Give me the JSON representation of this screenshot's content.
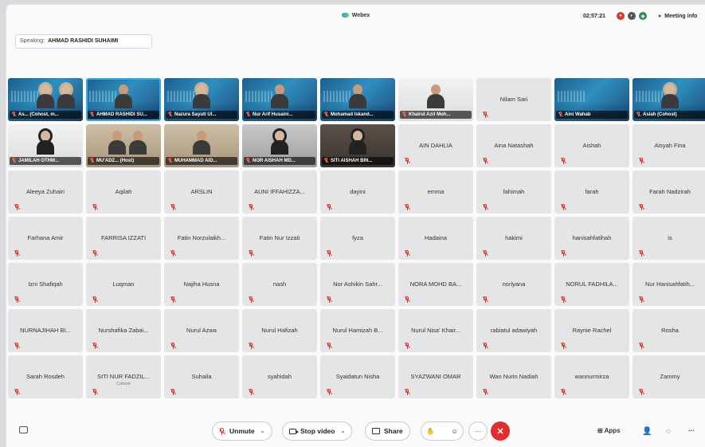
{
  "app": {
    "title": "Webex"
  },
  "topbar": {
    "clock": "02:57:21",
    "meeting_info": "Meeting info"
  },
  "speaking": {
    "label": "Speaking:",
    "name": "AHMAD RASHIDI SUHAIMI"
  },
  "participants": [
    {
      "name": "As... (Cohost, m...",
      "video": "blue",
      "person": "hijab2"
    },
    {
      "name": "AHMAD RASHIDI SU...",
      "video": "blue",
      "person": "man",
      "selected": true
    },
    {
      "name": "Nazura Sayuti Ul...",
      "video": "blue",
      "person": "hijab"
    },
    {
      "name": "Nur Arif Husaini...",
      "video": "blue",
      "person": "man"
    },
    {
      "name": "Mohamad Iskand...",
      "video": "blue",
      "person": "man"
    },
    {
      "name": "Khairul Azri Moh...",
      "video": "white",
      "person": "man"
    },
    {
      "name": "Nilam Sari"
    },
    {
      "name": "Aini Wahab",
      "video": "blue",
      "person": "none"
    },
    {
      "name": "Asiah (Cohost)",
      "video": "blue",
      "person": "hijab"
    },
    {
      "name": "JAMILAH OTHM...",
      "video": "white",
      "person": "hijabdk"
    },
    {
      "name": "MU'ADZ...        (Host)",
      "video": "room",
      "person": "man2"
    },
    {
      "name": "MUHAMMAD AID...",
      "video": "room",
      "person": "man"
    },
    {
      "name": "NOR AISHAH MD...",
      "video": "gray",
      "person": "hijabdk"
    },
    {
      "name": "SITI AISHAH BIN...",
      "video": "dark",
      "person": "hijabdk"
    },
    {
      "name": "AIN DAHLIA"
    },
    {
      "name": "Aina Natashah"
    },
    {
      "name": "Aishah"
    },
    {
      "name": "Aisyah Fina"
    },
    {
      "name": "Aleeya Zuhairi"
    },
    {
      "name": "Aqilah"
    },
    {
      "name": "ARSLIN"
    },
    {
      "name": "AUNI IFFAHIZZA..."
    },
    {
      "name": "dayini"
    },
    {
      "name": "emma"
    },
    {
      "name": "fahimah"
    },
    {
      "name": "farah"
    },
    {
      "name": "Farah Nadzirah"
    },
    {
      "name": "Farhana Amir"
    },
    {
      "name": "FARRISA IZZATI"
    },
    {
      "name": "Fatin Norzulaikh..."
    },
    {
      "name": "Fatin Nur Izzati"
    },
    {
      "name": "fyza"
    },
    {
      "name": "Hadaina"
    },
    {
      "name": "hakimi"
    },
    {
      "name": "hanisahfatihah"
    },
    {
      "name": "is"
    },
    {
      "name": "Izni Shafiqah"
    },
    {
      "name": "Luqman"
    },
    {
      "name": "Najiha Husna"
    },
    {
      "name": "nash"
    },
    {
      "name": "Nor Ashikin Sahr..."
    },
    {
      "name": "NORA MOHD BA..."
    },
    {
      "name": "norlyana"
    },
    {
      "name": "NORUL FADHILA..."
    },
    {
      "name": "Nur Hanisahfatih..."
    },
    {
      "name": "NURNAJIHAH BI..."
    },
    {
      "name": "Nurshafika Zabai..."
    },
    {
      "name": "Nurul Azwa"
    },
    {
      "name": "Nurul Hafizah"
    },
    {
      "name": "Nurul Hamizah B..."
    },
    {
      "name": "Nurul Nisa' Khair..."
    },
    {
      "name": "rabiatul adawiyah"
    },
    {
      "name": "Raynie Rachel"
    },
    {
      "name": "Rosha"
    },
    {
      "name": "Sarah Rosdeh"
    },
    {
      "name": "SITI NUR FADZIL...",
      "sub": "Cohost"
    },
    {
      "name": "Suhaila"
    },
    {
      "name": "syahidah"
    },
    {
      "name": "Syaidatun Nisha"
    },
    {
      "name": "SYAZWANI OMAR"
    },
    {
      "name": "Wan Nurin Nadiah"
    },
    {
      "name": "wannurmirza"
    },
    {
      "name": "Zammy"
    }
  ],
  "toolbar": {
    "unmute": "Unmute",
    "stop_video": "Stop video",
    "share": "Share",
    "more": "···",
    "end": "✕",
    "apps": "Apps",
    "overflow": "···"
  },
  "colors": {
    "end": "#e12d2d",
    "mute": "#c4392f",
    "selected": "#3aa7e8"
  }
}
